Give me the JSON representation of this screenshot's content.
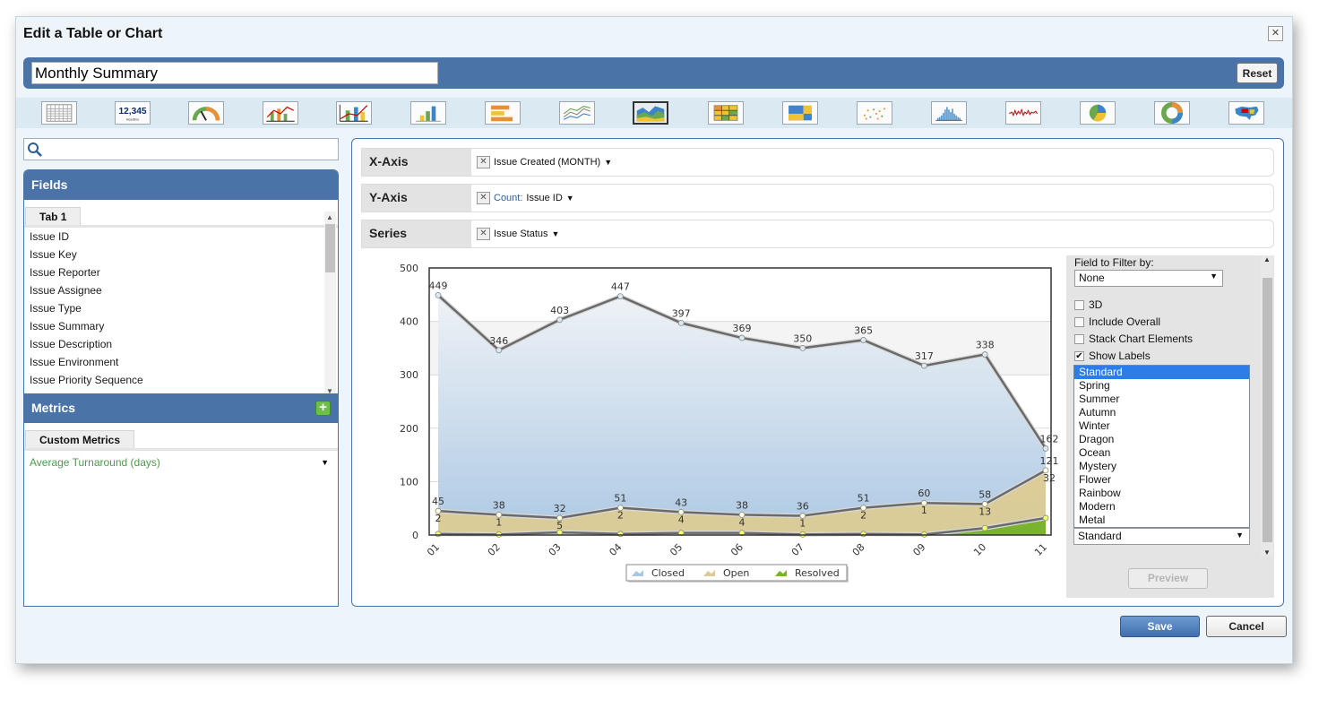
{
  "dialog": {
    "title": "Edit a Table or Chart",
    "close_glyph": "✕"
  },
  "name_bar": {
    "value": "Monthly Summary",
    "reset_label": "Reset"
  },
  "chart_types": [
    {
      "name": "table",
      "selected": false
    },
    {
      "name": "headline",
      "label": "12,345",
      "sublabel": "Headline",
      "selected": false
    },
    {
      "name": "gauge",
      "selected": false
    },
    {
      "name": "bar-line-combo",
      "selected": false
    },
    {
      "name": "bar-line-combo-2",
      "selected": false
    },
    {
      "name": "column",
      "selected": false
    },
    {
      "name": "horizontal-bar",
      "selected": false
    },
    {
      "name": "line",
      "selected": false
    },
    {
      "name": "area",
      "selected": true
    },
    {
      "name": "heatmap-table",
      "selected": false
    },
    {
      "name": "treemap",
      "selected": false
    },
    {
      "name": "scatter",
      "selected": false
    },
    {
      "name": "histogram",
      "selected": false
    },
    {
      "name": "sparkline",
      "selected": false
    },
    {
      "name": "pie",
      "selected": false
    },
    {
      "name": "donut",
      "selected": false
    },
    {
      "name": "map",
      "selected": false
    }
  ],
  "search": {
    "placeholder": ""
  },
  "fields": {
    "title": "Fields",
    "tab": "Tab 1",
    "items": [
      "Issue ID",
      "Issue Key",
      "Issue Reporter",
      "Issue Assignee",
      "Issue Type",
      "Issue Summary",
      "Issue Description",
      "Issue Environment",
      "Issue Priority Sequence"
    ]
  },
  "metrics": {
    "title": "Metrics",
    "tab": "Custom Metrics",
    "items": [
      "Average Turnaround (days)"
    ]
  },
  "axes": {
    "x": {
      "label": "X-Axis",
      "value": "Issue Created (MONTH)"
    },
    "y": {
      "label": "Y-Axis",
      "prefix": "Count:",
      "value": "Issue ID"
    },
    "series": {
      "label": "Series",
      "value": "Issue Status"
    }
  },
  "options": {
    "filter_label": "Field to Filter by:",
    "filter_value": "None",
    "checkboxes": [
      {
        "label": "3D",
        "checked": false
      },
      {
        "label": "Include Overall",
        "checked": false
      },
      {
        "label": "Stack Chart Elements",
        "checked": false
      },
      {
        "label": "Show Labels",
        "checked": true
      }
    ],
    "themes": [
      "Standard",
      "Spring",
      "Summer",
      "Autumn",
      "Winter",
      "Dragon",
      "Ocean",
      "Mystery",
      "Flower",
      "Rainbow",
      "Modern",
      "Metal"
    ],
    "selected_theme": "Standard",
    "theme_value": "Standard",
    "preview_label": "Preview"
  },
  "buttons": {
    "save": "Save",
    "cancel": "Cancel"
  },
  "colors": {
    "accent": "#4a74a8",
    "closed": "#b5cce0",
    "open": "#dccb94",
    "resolved": "#7ab32e",
    "selection": "#2b7de9"
  },
  "chart_data": {
    "type": "area",
    "categories": [
      "01",
      "02",
      "03",
      "04",
      "05",
      "06",
      "07",
      "08",
      "09",
      "10",
      "11"
    ],
    "ylim": [
      0,
      500
    ],
    "yticks": [
      0,
      100,
      200,
      300,
      400,
      500
    ],
    "grid": true,
    "legend": "bottom",
    "series": [
      {
        "name": "Closed",
        "values": [
          449,
          346,
          403,
          447,
          397,
          369,
          350,
          365,
          317,
          338,
          162
        ],
        "labels": [
          "449",
          "346",
          "403",
          "447",
          "397",
          "369",
          "350",
          "365",
          "317",
          "338",
          "162"
        ]
      },
      {
        "name": "Open",
        "values": [
          45,
          38,
          32,
          51,
          43,
          38,
          36,
          51,
          60,
          58,
          121
        ],
        "labels": [
          "45",
          "38",
          "32",
          "51",
          "43",
          "38",
          "36",
          "51",
          "60",
          "58",
          "121"
        ]
      },
      {
        "name": "Resolved",
        "values": [
          2,
          1,
          5,
          2,
          4,
          4,
          1,
          2,
          1,
          13,
          32
        ],
        "labels": [
          "2",
          "1",
          "5",
          "2",
          "4",
          "4",
          "1",
          "2",
          "1",
          "13",
          "32"
        ]
      }
    ]
  }
}
